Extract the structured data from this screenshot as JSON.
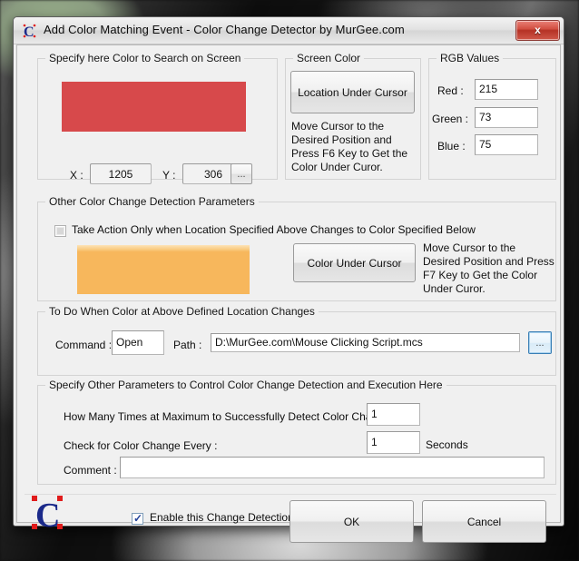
{
  "window": {
    "title": "Add Color Matching Event - Color Change Detector by MurGee.com",
    "close_label": "x",
    "app_icon": "murgee-c-logo-icon"
  },
  "search_color_group": {
    "legend": "Specify here Color to Search on Screen",
    "swatch_color": "#d7494b",
    "x_label": "X :",
    "x_value": "1205",
    "y_label": "Y :",
    "y_value": "306",
    "browse_label": "..."
  },
  "screen_color_group": {
    "legend": "Screen Color",
    "button_label": "Location Under Cursor",
    "help_text": "Move Cursor to the Desired Position and Press  F6  Key to Get the Color Under Curor."
  },
  "rgb_group": {
    "legend": "RGB Values",
    "red_label": "Red :",
    "red_value": "215",
    "green_label": "Green :",
    "green_value": "73",
    "blue_label": "Blue :",
    "blue_value": "75"
  },
  "other_params_group": {
    "legend": "Other Color Change Detection Parameters",
    "checkbox_label": "Take Action Only when Location Specified Above Changes to  Color Specified Below",
    "checkbox_checked": false,
    "swatch_color": "#f7b75c",
    "button_label": "Color Under Cursor",
    "help_text": "Move Cursor to the Desired Position and Press  F7  Key to Get the Color Under Curor."
  },
  "todo_group": {
    "legend": "To Do When Color at Above Defined Location Changes",
    "command_label": "Command :",
    "command_value": "Open",
    "path_label": "Path :",
    "path_value": "D:\\MurGee.com\\Mouse Clicking Script.mcs",
    "browse_label": "..."
  },
  "control_group": {
    "legend": "Specify Other Parameters to Control Color Change Detection and Execution Here",
    "max_times_label": "How Many Times at Maximum to Successfully Detect Color Change  :",
    "max_times_value": "1",
    "interval_label": "Check for Color Change Every :",
    "interval_value": "1",
    "interval_units": "Seconds",
    "comment_label": "Comment :",
    "comment_value": ""
  },
  "footer": {
    "logo": "murgee-c-logo-icon",
    "enable_label": "Enable this Change Detection",
    "enable_checked": true,
    "ok_label": "OK",
    "cancel_label": "Cancel"
  }
}
